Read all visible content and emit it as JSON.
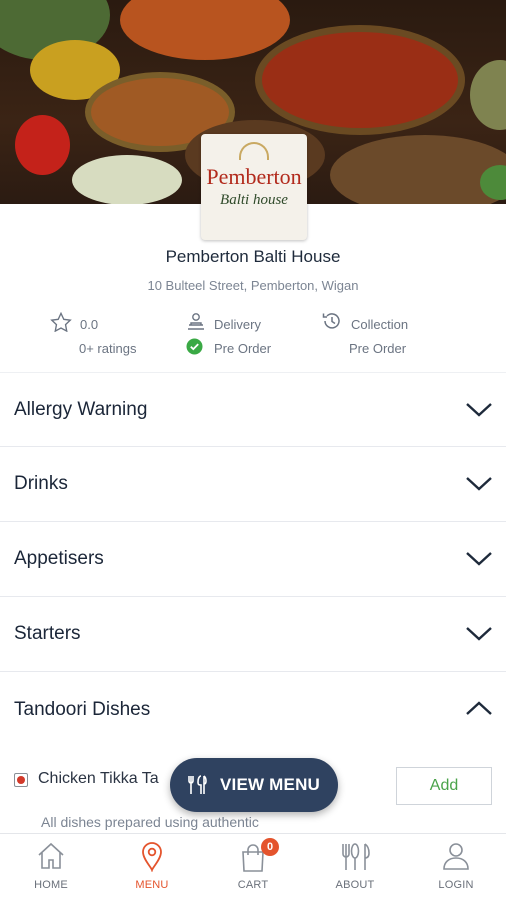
{
  "restaurant": {
    "name": "Pemberton Balti House",
    "address": "10 Bulteel Street, Pemberton, Wigan",
    "logo_line1": "Pemberton",
    "logo_line2": "Balti house"
  },
  "stats": {
    "rating": "0.0",
    "ratings_count": "0+ ratings",
    "delivery_label": "Delivery",
    "delivery_status": "Pre Order",
    "collection_label": "Collection",
    "collection_status": "Pre Order"
  },
  "categories": [
    {
      "label": "Allergy Warning",
      "expanded": false
    },
    {
      "label": "Drinks",
      "expanded": false
    },
    {
      "label": "Appetisers",
      "expanded": false
    },
    {
      "label": "Starters",
      "expanded": false
    },
    {
      "label": "Tandoori Dishes",
      "expanded": true
    }
  ],
  "dish": {
    "name": "Chicken Tikka Ta",
    "description": "All dishes prepared using authentic",
    "add_label": "Add"
  },
  "view_menu": {
    "label": "VIEW MENU"
  },
  "bottom_nav": {
    "items": [
      {
        "label": "HOME",
        "icon": "home-icon"
      },
      {
        "label": "MENU",
        "icon": "map-pin-icon",
        "active": true
      },
      {
        "label": "CART",
        "icon": "cart-icon",
        "badge": "0"
      },
      {
        "label": "ABOUT",
        "icon": "cutlery-icon"
      },
      {
        "label": "LOGIN",
        "icon": "user-icon"
      }
    ]
  },
  "colors": {
    "accent": "#e4542d",
    "navy": "#2f4260",
    "green": "#4aa34a",
    "text": "#1e2a3b"
  }
}
